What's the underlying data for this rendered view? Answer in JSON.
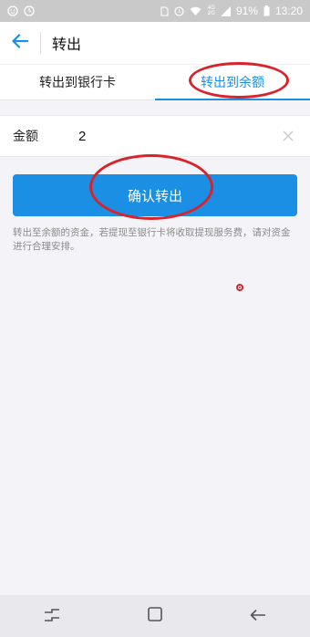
{
  "status_bar": {
    "battery_percent": "91%",
    "time": "13:20",
    "network_top": "4G",
    "network_bottom": "2G",
    "icons": [
      "face-icon",
      "alarm-icon",
      "sim-icon",
      "clock-icon",
      "wifi-icon",
      "signal-icon",
      "battery-icon"
    ]
  },
  "header": {
    "title": "转出",
    "back_icon": "arrow-left-icon"
  },
  "tabs": [
    {
      "label": "转出到银行卡",
      "active": false
    },
    {
      "label": "转出到余额",
      "active": true
    }
  ],
  "form": {
    "amount_label": "金额",
    "amount_value": "2",
    "clear_icon": "close-icon"
  },
  "confirm_button": {
    "label": "确认转出"
  },
  "hint": "转出至余额的资金，若提现至银行卡将收取提现服务费，请对资金进行合理安排。",
  "colors": {
    "accent": "#1a8fe3",
    "annotation_red": "#d9222a",
    "background": "#f4f4f8"
  },
  "navigation": {
    "icons": [
      "recent-apps-icon",
      "home-icon",
      "back-icon"
    ]
  }
}
